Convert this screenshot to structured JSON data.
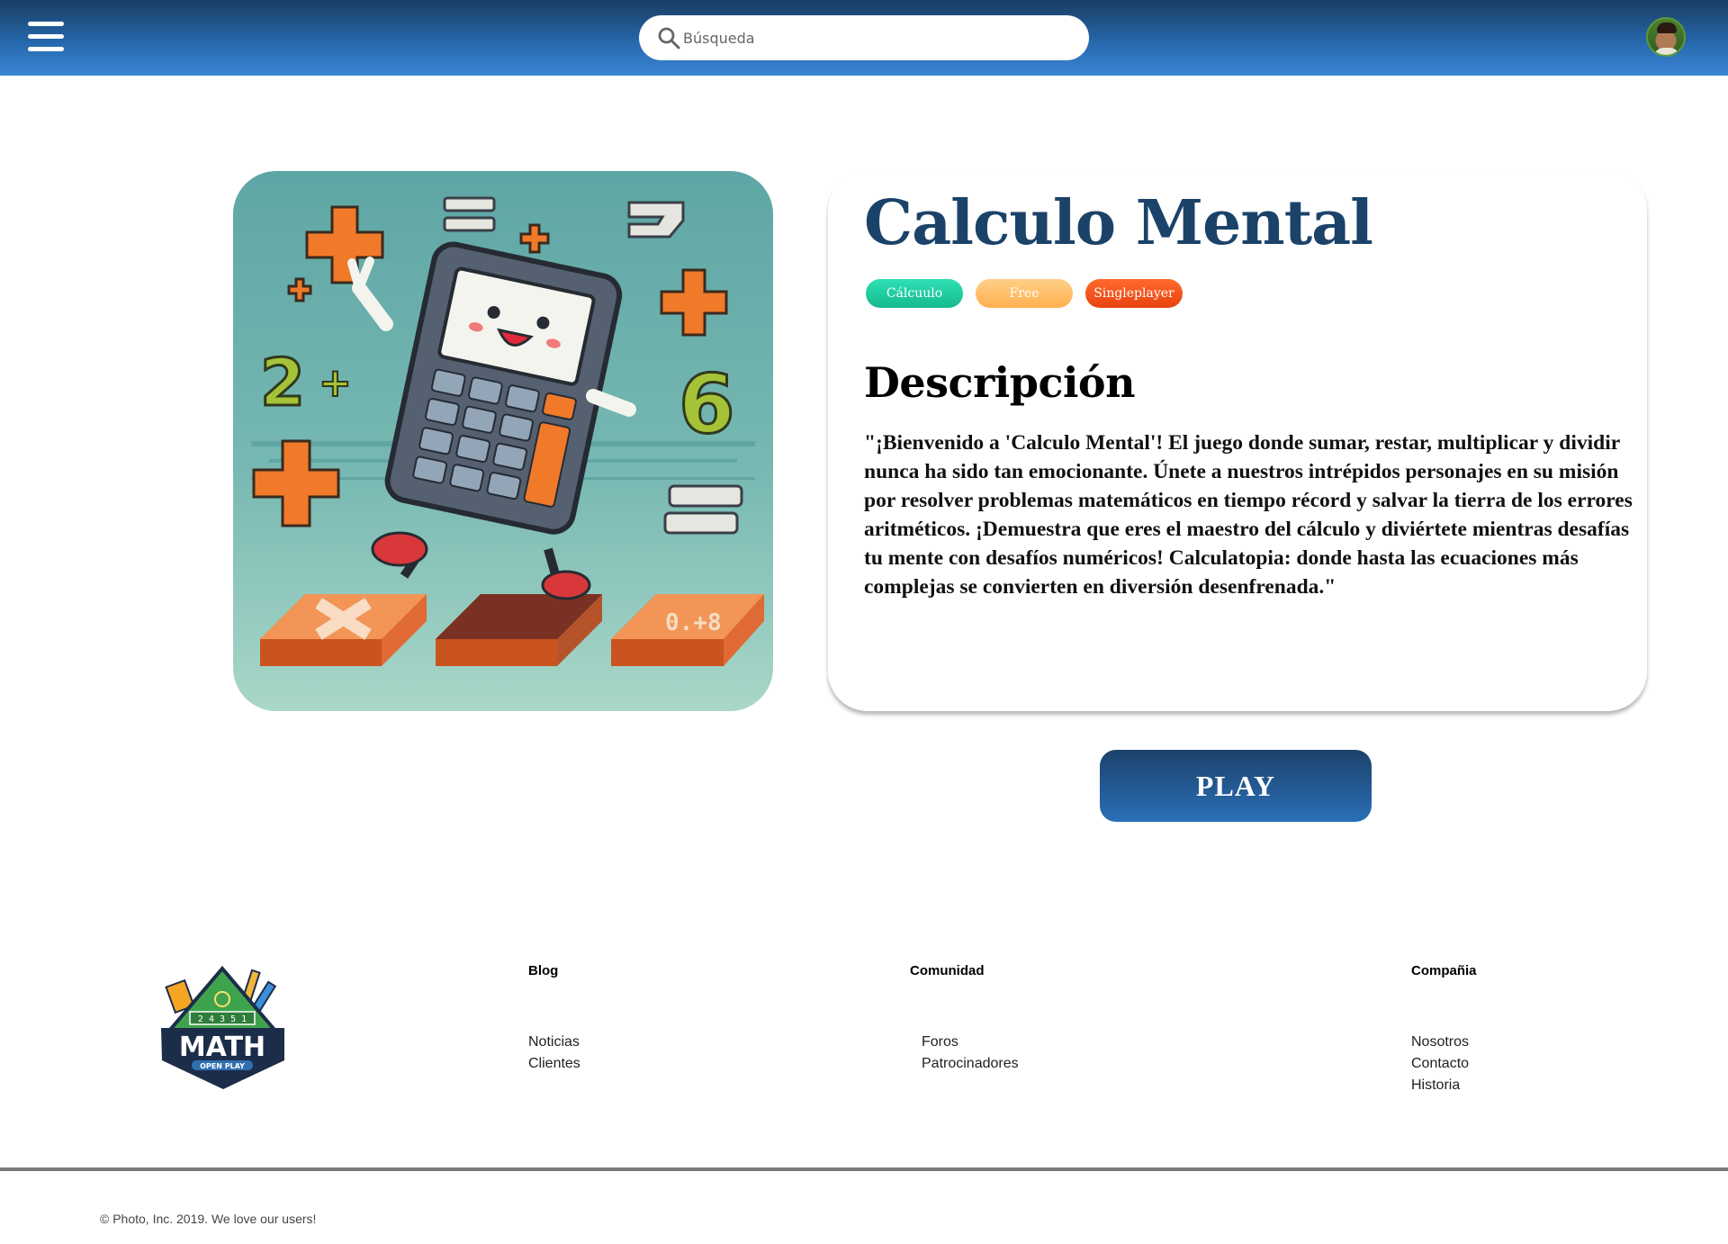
{
  "header": {
    "search_placeholder": "Búsqueda"
  },
  "game": {
    "title": "Calculo Mental",
    "tags": [
      "Cálcuulo",
      "Free",
      "Singleplayer"
    ],
    "description_heading": "Descripción",
    "description": "\"¡Bienvenido a 'Calculo Mental'! El juego donde sumar, restar, multiplicar y dividir nunca ha sido tan emocionante. Únete a nuestros intrépidos personajes en su misión por resolver problemas matemáticos en tiempo récord y salvar la tierra de los errores aritméticos. ¡Demuestra que eres el maestro del cálculo y diviértete mientras desafías tu mente con desafíos numéricos! Calculatopia: donde hasta las ecuaciones más complejas se convierten en diversión desenfrenada.\"",
    "play_label": "PLAY"
  },
  "footer": {
    "logo_text": "MATH",
    "logo_subtext": "OPEN PLAY",
    "logo_numbers": "2 4 3 5 1",
    "columns": [
      {
        "title": "Blog",
        "links": [
          "Noticias",
          "Clientes"
        ]
      },
      {
        "title": "Comunidad",
        "links": [
          "Foros",
          "Patrocinadores"
        ]
      },
      {
        "title": "Compañia",
        "links": [
          "Nosotros",
          "Contacto",
          "Historia"
        ]
      }
    ],
    "copyright": "© Photo, Inc. 2019. We love our users!"
  },
  "colors": {
    "header_dark": "#1a3d63",
    "header_light": "#3a86d6",
    "title_blue": "#1b4369",
    "tag_calculo": "#16b98f",
    "tag_free": "#ffb050",
    "tag_singleplayer": "#e8420f",
    "play_button": "#2a6fb7"
  },
  "icons": [
    "menu-icon",
    "search-icon",
    "user-avatar",
    "math-open-play-logo"
  ]
}
